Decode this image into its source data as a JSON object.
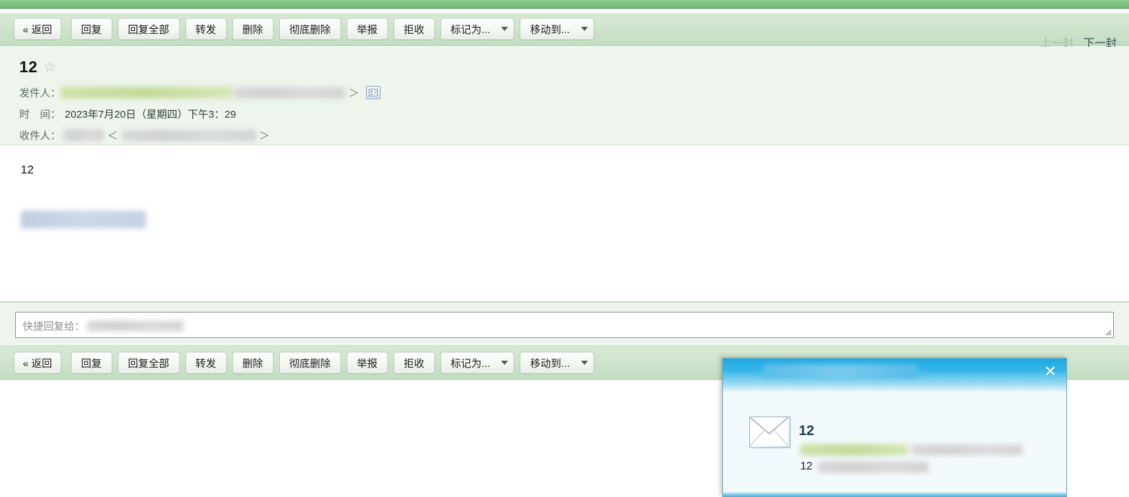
{
  "toolbar": {
    "buttons": [
      {
        "label": "« 返回",
        "name": "back-button",
        "dropdown": false
      },
      {
        "label": "回复",
        "name": "reply-button",
        "dropdown": false
      },
      {
        "label": "回复全部",
        "name": "reply-all-button",
        "dropdown": false
      },
      {
        "label": "转发",
        "name": "forward-button",
        "dropdown": false
      },
      {
        "label": "删除",
        "name": "delete-button",
        "dropdown": false
      },
      {
        "label": "彻底删除",
        "name": "permanent-delete-button",
        "dropdown": false
      },
      {
        "label": "举报",
        "name": "report-button",
        "dropdown": false
      },
      {
        "label": "拒收",
        "name": "reject-button",
        "dropdown": false
      },
      {
        "label": "标记为...",
        "name": "mark-as-dropdown",
        "dropdown": true
      },
      {
        "label": "移动到...",
        "name": "move-to-dropdown",
        "dropdown": true
      }
    ],
    "prev_label": "上一封",
    "next_label": "下一封"
  },
  "mail": {
    "subject": "12",
    "star_icon": "star-icon",
    "from_label": "发件人：",
    "time_label": "时　间：",
    "to_label": "收件人：",
    "time_value": "2023年7月20日（星期四）下午3：29",
    "angle_close": "＞",
    "angle_open": "＜",
    "body_text": "12"
  },
  "header_icons": [
    {
      "name": "copy-to-window-icon"
    },
    {
      "name": "view-source-icon"
    },
    {
      "name": "download-icon"
    },
    {
      "name": "print-icon"
    }
  ],
  "header_chevron": "〉〉",
  "reply": {
    "placeholder_label": "快捷回复给：",
    "value": ""
  },
  "popup": {
    "close_label": "✕",
    "subject": "12",
    "preview_text": "12",
    "envelope_icon": "envelope-icon"
  },
  "colors": {
    "band_green": "#7bc47f",
    "toolbar_green": "#cde3cb",
    "header_green": "#edf5ed",
    "popup_blue": "#35b5e8",
    "next_link": "#39515e",
    "prev_link": "#a7bda7"
  }
}
